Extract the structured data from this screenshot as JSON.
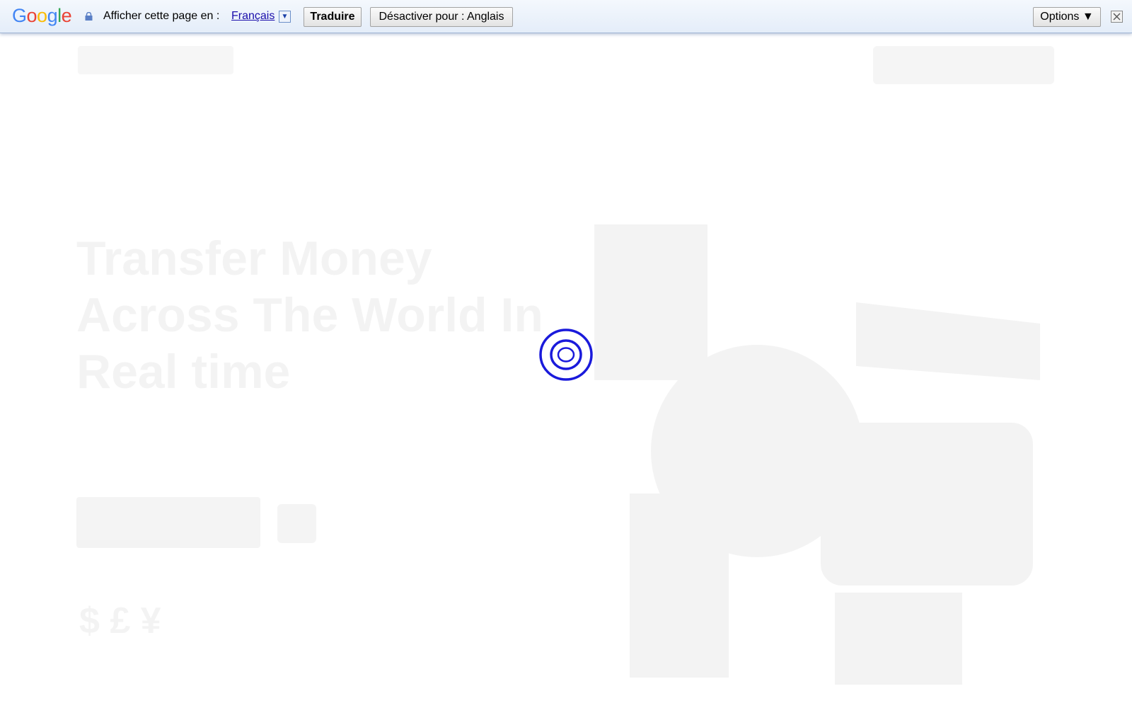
{
  "translate_bar": {
    "logo_letters": [
      "G",
      "o",
      "o",
      "g",
      "l",
      "e"
    ],
    "logo_colors": [
      "#4285f4",
      "#ea4335",
      "#fbbc05",
      "#4285f4",
      "#34a853",
      "#ea4335"
    ],
    "prompt": "Afficher cette page en :",
    "language": "Français",
    "language_dropdown_icon": "▼",
    "translate_button": "Traduire",
    "disable_button": "Désactiver pour : Anglais",
    "options_button": "Options ▼",
    "close_icon": "close-icon",
    "lock_icon": "lock-icon"
  },
  "background_page": {
    "headline": "Transfer Money Across The World In Real time",
    "currency_symbols": "$ £ ¥"
  },
  "loader": {
    "icon": "loading-spinner-icon",
    "color": "#1a1adb"
  }
}
